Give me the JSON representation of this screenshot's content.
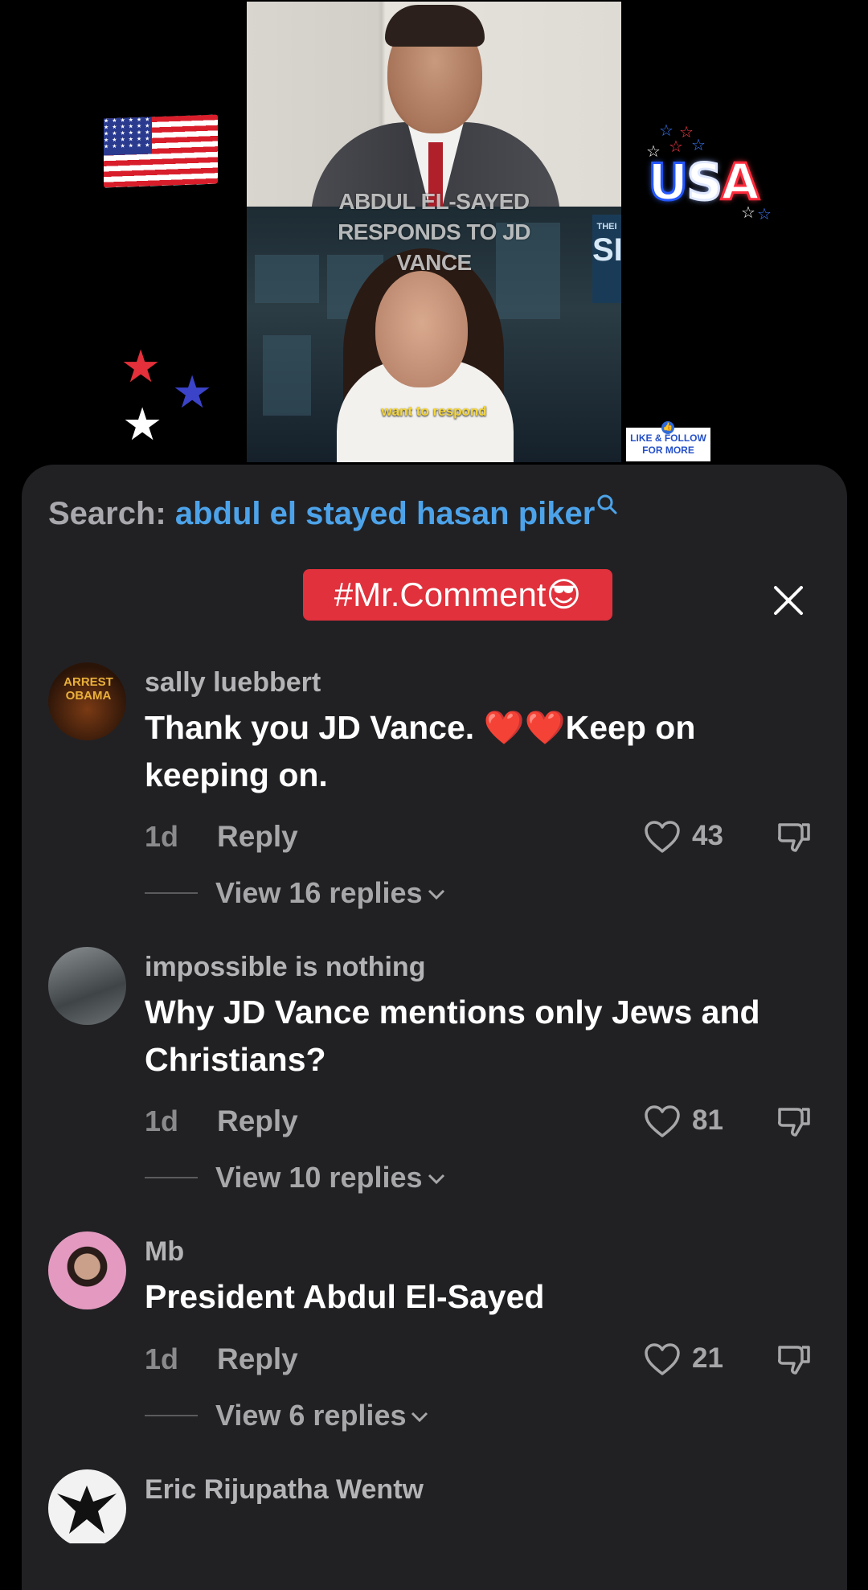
{
  "video": {
    "title": "ABDUL EL-SAYED RESPONDS TO JD VANCE",
    "caption": "want to respond",
    "show_logo_top": "THEI",
    "show_logo_big": "SI",
    "sticker_usa": [
      "U",
      "S",
      "A"
    ],
    "like_follow_line1": "LIKE & FOLLOW",
    "like_follow_line2": "FOR MORE"
  },
  "search": {
    "prefix": "Search:",
    "term": "abdul el stayed hasan piker"
  },
  "tag": "#Mr.Comment😎",
  "colors": {
    "sheet": "#212124",
    "search_term": "#4da3e9",
    "tag_bg": "#e0313c"
  },
  "comments": [
    {
      "user": "sally luebbert",
      "text": "Thank you JD Vance. ❤️❤️Keep on keeping on.",
      "age": "1d",
      "reply": "Reply",
      "likes": "43",
      "view_replies": "View 16 replies",
      "avatar_text": "ARREST OBAMA"
    },
    {
      "user": "impossible is nothing",
      "text": "Why JD Vance mentions only Jews and Christians?",
      "age": "1d",
      "reply": "Reply",
      "likes": "81",
      "view_replies": "View 10 replies"
    },
    {
      "user": "Mb",
      "text": "President Abdul El-Sayed",
      "age": "1d",
      "reply": "Reply",
      "likes": "21",
      "view_replies": "View 6 replies"
    },
    {
      "user": "Eric Rijupatha Wentw"
    }
  ]
}
